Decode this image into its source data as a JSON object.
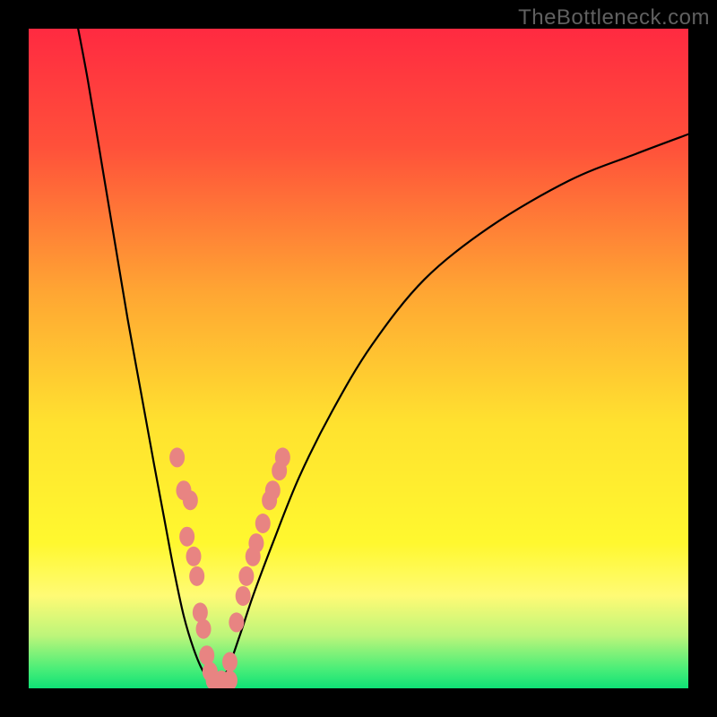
{
  "watermark": "TheBottleneck.com",
  "chart_data": {
    "type": "line",
    "title": "",
    "xlabel": "",
    "ylabel": "",
    "xlim": [
      0,
      100
    ],
    "ylim": [
      0,
      100
    ],
    "background_gradient": {
      "stops": [
        {
          "offset": 0.0,
          "color": "#ff2a41"
        },
        {
          "offset": 0.18,
          "color": "#ff513a"
        },
        {
          "offset": 0.4,
          "color": "#ffa633"
        },
        {
          "offset": 0.6,
          "color": "#ffe22f"
        },
        {
          "offset": 0.78,
          "color": "#fff82f"
        },
        {
          "offset": 0.86,
          "color": "#fffb75"
        },
        {
          "offset": 0.92,
          "color": "#bdf57a"
        },
        {
          "offset": 0.97,
          "color": "#4bee78"
        },
        {
          "offset": 1.0,
          "color": "#0fe176"
        }
      ]
    },
    "series": [
      {
        "name": "left-curve",
        "values_xy": [
          [
            7.5,
            100
          ],
          [
            9,
            92
          ],
          [
            11,
            80
          ],
          [
            13,
            68
          ],
          [
            15,
            56
          ],
          [
            17,
            45
          ],
          [
            19,
            34
          ],
          [
            20.5,
            26
          ],
          [
            22,
            18
          ],
          [
            23.5,
            11
          ],
          [
            25,
            6
          ],
          [
            26.5,
            2.5
          ],
          [
            28,
            1
          ]
        ]
      },
      {
        "name": "right-curve",
        "values_xy": [
          [
            28.5,
            1
          ],
          [
            30,
            2.5
          ],
          [
            32,
            8
          ],
          [
            34,
            14
          ],
          [
            37,
            22
          ],
          [
            41,
            32
          ],
          [
            46,
            42
          ],
          [
            52,
            52
          ],
          [
            60,
            62
          ],
          [
            70,
            70
          ],
          [
            82,
            77
          ],
          [
            92,
            81
          ],
          [
            100,
            84
          ]
        ]
      }
    ],
    "markers": {
      "name": "salmon-dots",
      "color": "#e88482",
      "values_xy": [
        [
          22.5,
          35
        ],
        [
          23.5,
          30
        ],
        [
          24.5,
          28.5
        ],
        [
          24,
          23
        ],
        [
          25,
          20
        ],
        [
          25.5,
          17
        ],
        [
          26,
          11.5
        ],
        [
          26.5,
          9
        ],
        [
          27,
          5
        ],
        [
          27.5,
          2.5
        ],
        [
          28,
          1.2
        ],
        [
          29.2,
          1.2
        ],
        [
          30.5,
          1.2
        ],
        [
          30.5,
          4
        ],
        [
          31.5,
          10
        ],
        [
          32.5,
          14
        ],
        [
          33,
          17
        ],
        [
          34,
          20
        ],
        [
          34.5,
          22
        ],
        [
          35.5,
          25
        ],
        [
          36.5,
          28.5
        ],
        [
          37,
          30
        ],
        [
          38,
          33
        ],
        [
          38.5,
          35
        ]
      ]
    }
  }
}
